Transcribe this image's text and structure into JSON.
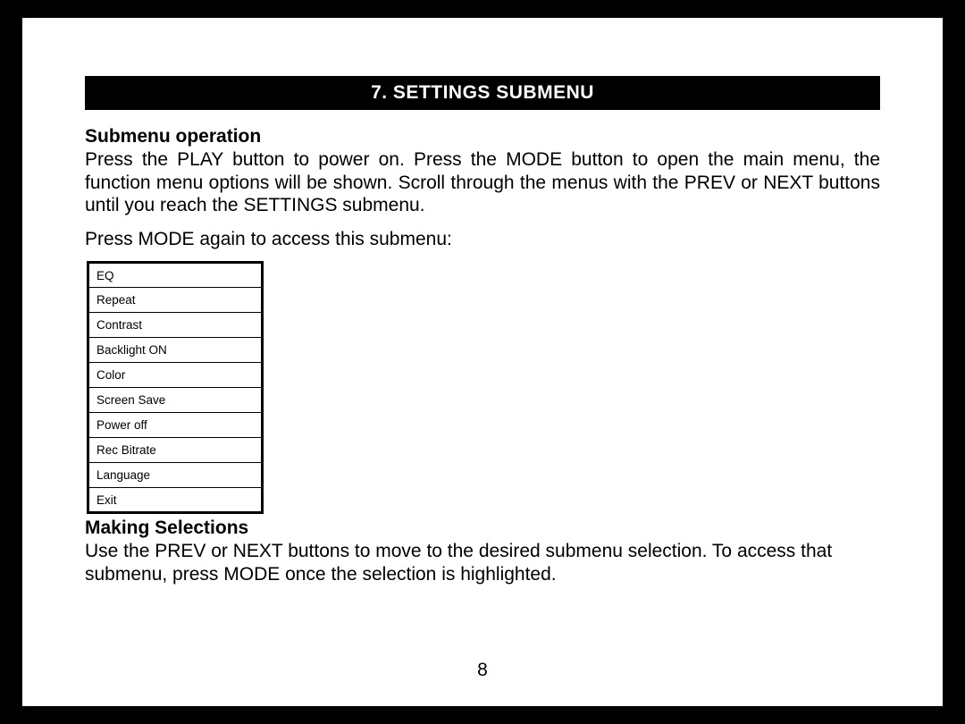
{
  "header": {
    "title": "7.  SETTINGS SUBMENU"
  },
  "section1": {
    "heading": "Submenu operation",
    "paragraph1": "Press the PLAY button to power on. Press the MODE button to open the main menu, the function menu options will be shown. Scroll through the menus with the PREV or NEXT buttons until you reach the SETTINGS submenu.",
    "paragraph2": "Press MODE again to access this submenu:"
  },
  "submenu_items": [
    "EQ",
    "Repeat",
    "Contrast",
    "Backlight ON",
    "Color",
    "Screen Save",
    "Power off",
    "Rec Bitrate",
    "Language",
    "Exit"
  ],
  "section2": {
    "heading": "Making Selections",
    "paragraph": "Use the PREV or NEXT buttons to move to the desired submenu selection.  To access that submenu, press MODE once the selection is highlighted."
  },
  "page_number": "8"
}
